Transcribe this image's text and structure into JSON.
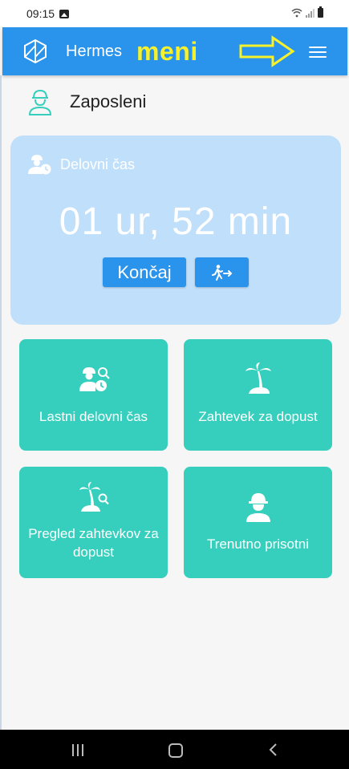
{
  "status_bar": {
    "time": "09:15"
  },
  "app_bar": {
    "title": "Hermes",
    "annotation": "meni"
  },
  "page": {
    "title": "Zaposleni"
  },
  "work_time": {
    "label": "Delovni čas",
    "elapsed": "01 ur, 52 min",
    "end_button": "Končaj"
  },
  "tiles": [
    {
      "label": "Lastni delovni čas",
      "icon": "worker-clock-search-icon"
    },
    {
      "label": "Zahtevek za dopust",
      "icon": "palm-island-icon"
    },
    {
      "label": "Pregled zahtevkov za dopust",
      "icon": "palm-island-search-icon"
    },
    {
      "label": "Trenutno prisotni",
      "icon": "worker-helmet-icon"
    }
  ],
  "colors": {
    "app_bar": "#2a93ec",
    "annotation": "#f6f12a",
    "card": "#bfdffa",
    "tile": "#36cfbd",
    "button": "#2a93ec"
  }
}
